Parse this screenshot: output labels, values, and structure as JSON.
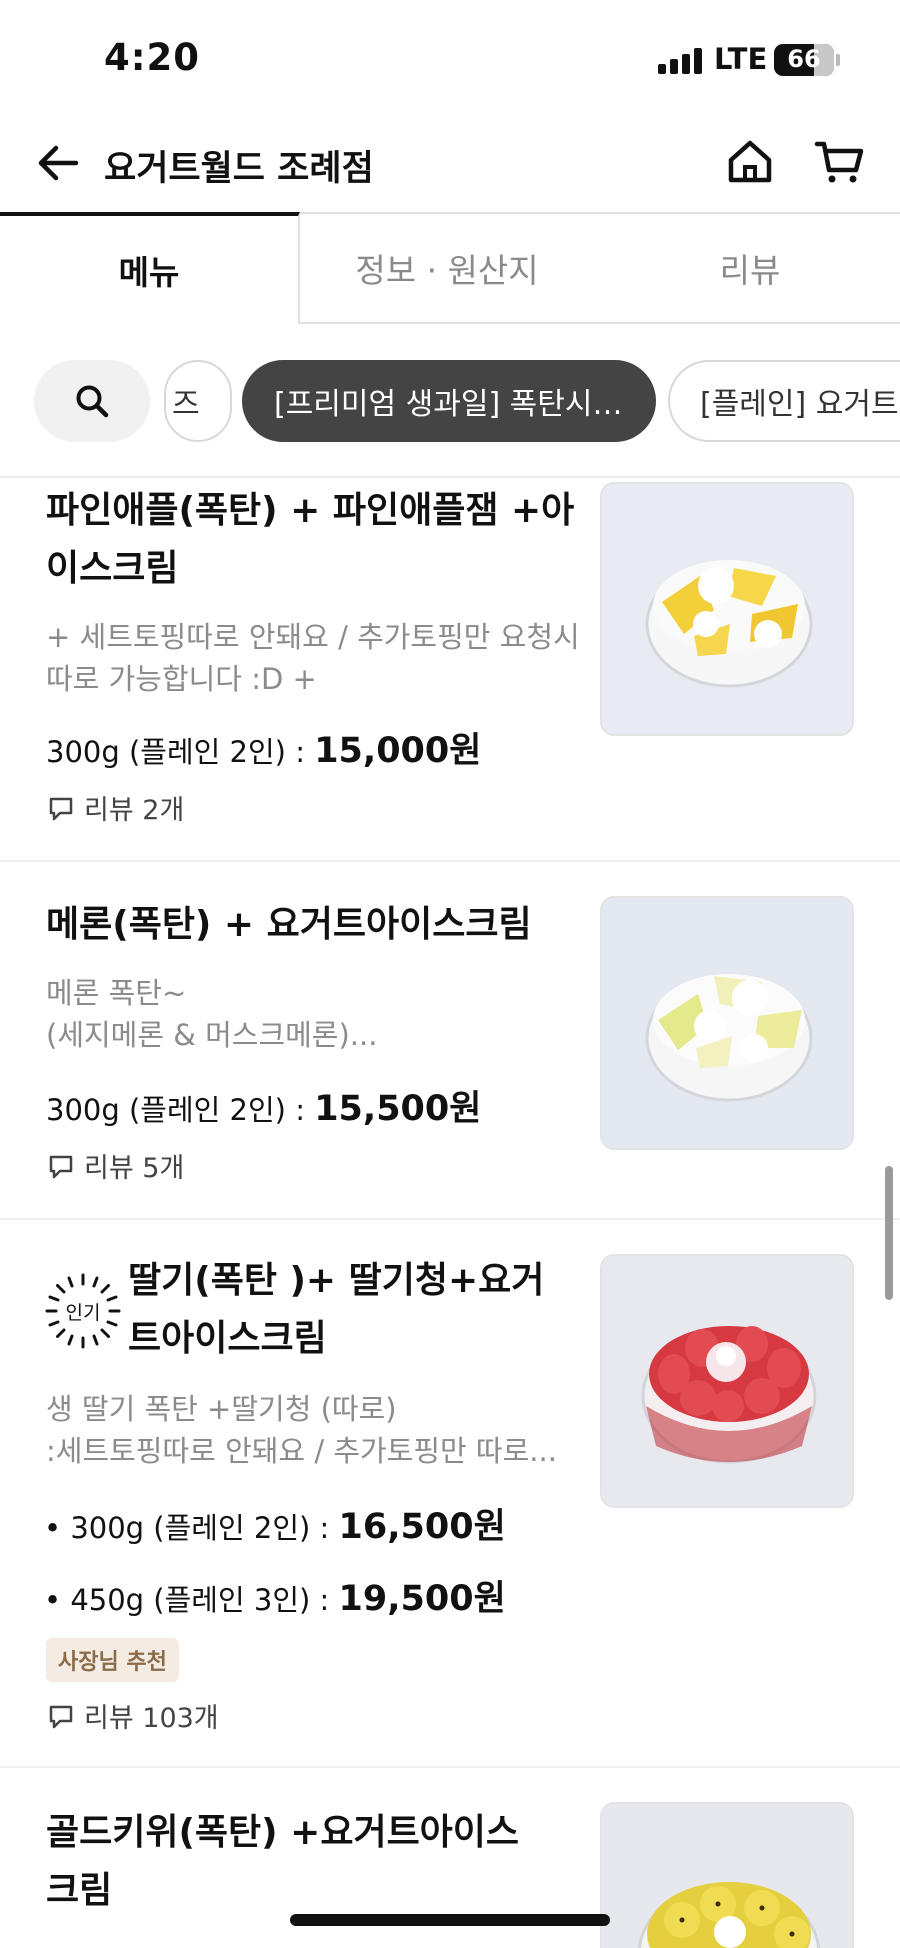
{
  "status_bar": {
    "time": "4:20",
    "network": "LTE",
    "battery": "66"
  },
  "header": {
    "title": "요거트월드 조례점"
  },
  "tabs": [
    {
      "label": "메뉴",
      "active": true
    },
    {
      "label": "정보 · 원산지",
      "active": false
    },
    {
      "label": "리뷰",
      "active": false
    }
  ],
  "categories": [
    {
      "label": "즈"
    },
    {
      "label": "[프리미엄 생과일] 폭탄시…",
      "selected": true
    },
    {
      "label": "[플레인] 요거트"
    }
  ],
  "menu_items": [
    {
      "name": "파인애플(폭탄) + 파인애플잼 +아이스크림",
      "description": "+ 세트토핑따로 안돼요 / 추가토핑만 요청시 따로 가능합니다 :D +",
      "prices": [
        {
          "label": "300g (플레인 2인) : ",
          "price": "15,000원"
        }
      ],
      "review": "리뷰 2개"
    },
    {
      "name": "메론(폭탄) + 요거트아이스크림",
      "description_lines": [
        "메론 폭탄~",
        "(세지메론 & 머스크메론)..."
      ],
      "prices": [
        {
          "label": "300g  (플레인 2인) : ",
          "price": "15,500원"
        }
      ],
      "review": "리뷰 5개"
    },
    {
      "badge": "인기",
      "name_lines": [
        "딸기(폭탄 )+ 딸기청+요거",
        "트아이스크림"
      ],
      "description_lines": [
        "생 딸기 폭탄 +딸기청 (따로)",
        ":세트토핑따로 안돼요 / 추가토핑만 따로..."
      ],
      "prices": [
        {
          "label": "• 300g (플레인 2인) : ",
          "price": "16,500원"
        },
        {
          "label": "• 450g (플레인 3인) : ",
          "price": "19,500원"
        }
      ],
      "tag": "사장님 추천",
      "review": "리뷰 103개"
    },
    {
      "name_lines": [
        "골드키위(폭탄) +요거트아이스",
        "크림"
      ]
    }
  ],
  "colors": {
    "selected_chip": "#444444",
    "owner_tag_bg": "#f4ece3",
    "owner_tag_text": "#8a6b4a"
  }
}
